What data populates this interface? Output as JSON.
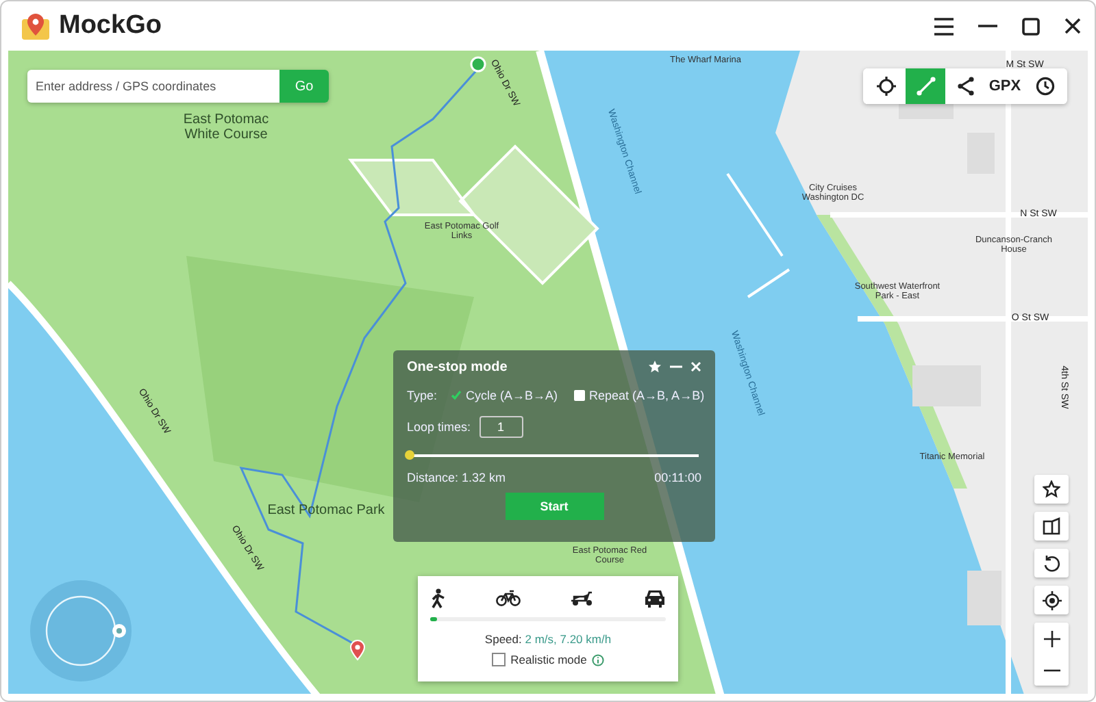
{
  "app": {
    "name": "MockGo"
  },
  "search": {
    "placeholder": "Enter address / GPS coordinates",
    "button": "Go"
  },
  "toolbar": [
    {
      "kind": "teleport",
      "selected": false
    },
    {
      "kind": "route",
      "selected": true
    },
    {
      "kind": "share",
      "selected": false
    },
    {
      "kind": "gpx",
      "label": "GPX",
      "selected": false
    },
    {
      "kind": "history",
      "selected": false
    }
  ],
  "map_labels": [
    {
      "text": "East Potomac White Course",
      "kind": "area"
    },
    {
      "text": "East Potomac Golf Links",
      "kind": "poi"
    },
    {
      "text": "East Potomac Park",
      "kind": "area"
    },
    {
      "text": "East Potomac Red Course",
      "kind": "poi"
    },
    {
      "text": "Ohio Dr SW",
      "kind": "road"
    },
    {
      "text": "Ohio Dr SW",
      "kind": "road"
    },
    {
      "text": "Ohio Dr SW",
      "kind": "road"
    },
    {
      "text": "Washington Channel",
      "kind": "water"
    },
    {
      "text": "Washington Channel",
      "kind": "water"
    },
    {
      "text": "The Wharf Marina",
      "kind": "poi"
    },
    {
      "text": "M St SW",
      "kind": "road"
    },
    {
      "text": "N St SW",
      "kind": "road"
    },
    {
      "text": "O St SW",
      "kind": "road"
    },
    {
      "text": "4th St SW",
      "kind": "road"
    },
    {
      "text": "City Cruises Washington DC",
      "kind": "poi"
    },
    {
      "text": "Duncanson-Cranch House",
      "kind": "poi"
    },
    {
      "text": "Southwest Waterfront Park - East",
      "kind": "poi"
    },
    {
      "text": "Titanic Memorial",
      "kind": "poi"
    }
  ],
  "dialog": {
    "title": "One-stop mode",
    "type_label": "Type:",
    "type_options": [
      {
        "label": "Cycle (A→B→A)",
        "selected": true
      },
      {
        "label": "Repeat (A→B, A→B)",
        "selected": false
      }
    ],
    "loop_label": "Loop times:",
    "loop_value": "1",
    "progress": {
      "level": 0
    },
    "distance": "Distance: 1.32 km",
    "time": "00:11:00",
    "start": "Start"
  },
  "transport": {
    "modes": [
      {
        "kind": "walk"
      },
      {
        "kind": "bike"
      },
      {
        "kind": "scooter"
      },
      {
        "kind": "car"
      }
    ],
    "speed": {
      "level": 0.03
    },
    "speed_label": "Speed:",
    "speed_value": "2 m/s, 7.20 km/h",
    "realistic_mode": {
      "label": "Realistic mode",
      "checked": false
    }
  }
}
